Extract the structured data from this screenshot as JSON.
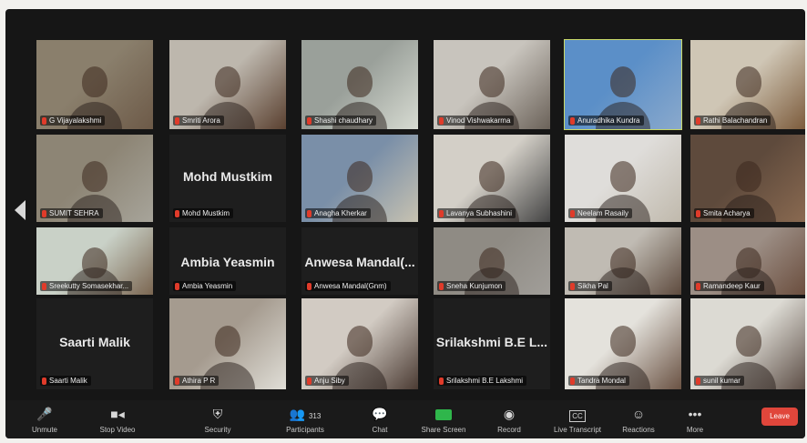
{
  "colors": {
    "background": "#161616",
    "tile": "#1e1e1e",
    "active_border": "#c9d96a",
    "mic_muted": "#e03b2a",
    "leave": "#e0463b"
  },
  "participants": [
    {
      "name": "G Vijayalakshmi",
      "type": "video"
    },
    {
      "name": "Smriti Arora",
      "type": "video"
    },
    {
      "name": "Shashi chaudhary",
      "type": "video"
    },
    {
      "name": "Vinod Vishwakarma",
      "type": "video"
    },
    {
      "name": "Anuradhika Kundra",
      "type": "video",
      "active": true
    },
    {
      "name": "Rathi Balachandran",
      "type": "video"
    },
    {
      "name": "SUMIT SEHRA",
      "type": "video"
    },
    {
      "name": "Mohd Mustkim",
      "type": "name",
      "display": "Mohd Mustkim"
    },
    {
      "name": "Anagha Kherkar",
      "type": "video"
    },
    {
      "name": "Lavanya Subhashini",
      "type": "video"
    },
    {
      "name": "Neelam Rasaily",
      "type": "video"
    },
    {
      "name": "Smita Acharya",
      "type": "video"
    },
    {
      "name": "Sreekutty Somasekhar...",
      "type": "video"
    },
    {
      "name": "Ambia Yeasmin",
      "type": "name",
      "display": "Ambia Yeasmin"
    },
    {
      "name": "Anwesa Mandal(Gnm)",
      "type": "name",
      "display": "Anwesa Mandal(..."
    },
    {
      "name": "Sneha Kunjumon",
      "type": "video"
    },
    {
      "name": "Sikha Pal",
      "type": "video"
    },
    {
      "name": "Ramandeep Kaur",
      "type": "video"
    },
    {
      "name": "Saarti Malik",
      "type": "name",
      "display": "Saarti Malik"
    },
    {
      "name": "Athira P R",
      "type": "video"
    },
    {
      "name": "Anju Siby",
      "type": "video"
    },
    {
      "name": "Srilakshmi B.E Lakshmi",
      "type": "name",
      "display": "Srilakshmi B.E L..."
    },
    {
      "name": "Tandra Mondal",
      "type": "video"
    },
    {
      "name": "sunil kumar",
      "type": "video"
    }
  ],
  "toolbar": {
    "unmute": "Unmute",
    "stop_video": "Stop Video",
    "security": "Security",
    "participants": "Participants",
    "participants_count": "313",
    "chat": "Chat",
    "share_screen": "Share Screen",
    "record": "Record",
    "live_transcript": "Live Transcript",
    "reactions": "Reactions",
    "more": "More",
    "leave": "Leave"
  }
}
